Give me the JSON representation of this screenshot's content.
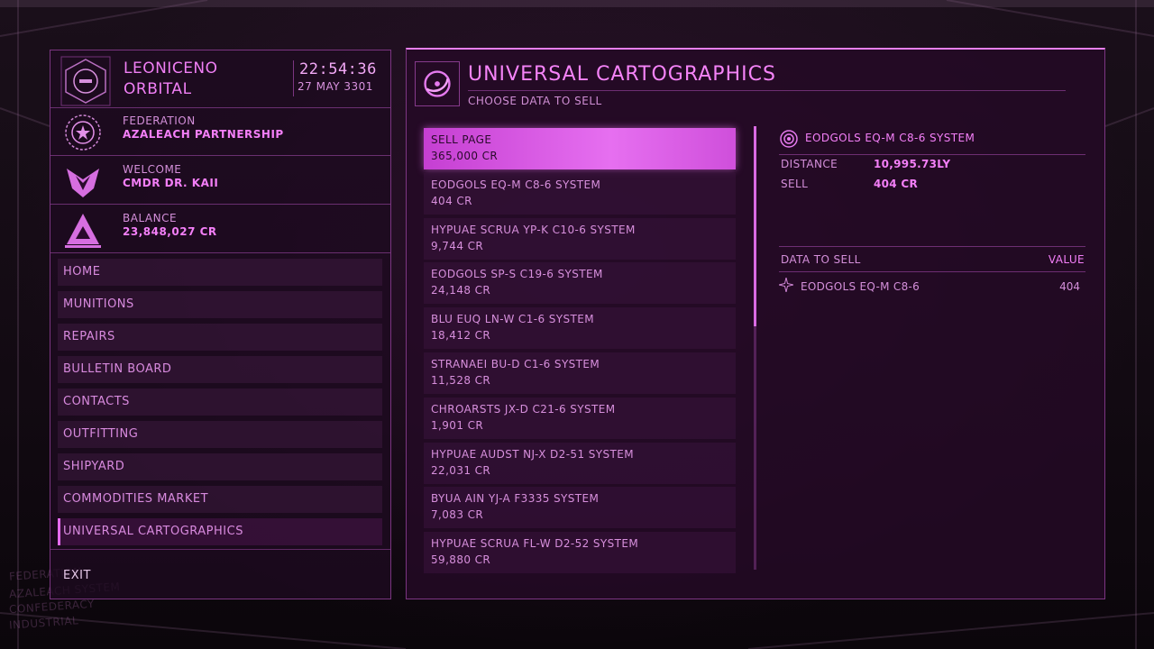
{
  "station": {
    "name_line1": "LEONICENO",
    "name_line2": "ORBITAL",
    "time": "22:54:36",
    "date": "27 MAY 3301"
  },
  "faction": {
    "label": "FEDERATION",
    "value": "AZALEACH PARTNERSHIP"
  },
  "welcome": {
    "label": "WELCOME",
    "value": "CMDR DR. KAII"
  },
  "balance": {
    "label": "BALANCE",
    "value": "23,848,027 CR"
  },
  "nav": {
    "items": [
      {
        "label": "HOME"
      },
      {
        "label": "MUNITIONS"
      },
      {
        "label": "REPAIRS"
      },
      {
        "label": "BULLETIN BOARD"
      },
      {
        "label": "CONTACTS"
      },
      {
        "label": "OUTFITTING"
      },
      {
        "label": "SHIPYARD"
      },
      {
        "label": "COMMODITIES MARKET"
      },
      {
        "label": "UNIVERSAL CARTOGRAPHICS"
      }
    ],
    "selected_index": 8,
    "exit_label": "EXIT"
  },
  "main": {
    "title": "UNIVERSAL CARTOGRAPHICS",
    "subtitle": "CHOOSE DATA TO SELL",
    "list": [
      {
        "name": "SELL PAGE",
        "value": "365,000 CR"
      },
      {
        "name": "EODGOLS EQ-M C8-6 SYSTEM",
        "value": "404 CR"
      },
      {
        "name": "HYPUAE SCRUA YP-K C10-6 SYSTEM",
        "value": "9,744 CR"
      },
      {
        "name": "EODGOLS SP-S C19-6 SYSTEM",
        "value": "24,148 CR"
      },
      {
        "name": "BLU EUQ LN-W C1-6 SYSTEM",
        "value": "18,412 CR"
      },
      {
        "name": "STRANAEI BU-D C1-6 SYSTEM",
        "value": "11,528 CR"
      },
      {
        "name": "CHROARSTS JX-D C21-6 SYSTEM",
        "value": "1,901 CR"
      },
      {
        "name": "HYPUAE AUDST NJ-X D2-51 SYSTEM",
        "value": "22,031 CR"
      },
      {
        "name": "BYUA AIN YJ-A F3335 SYSTEM",
        "value": "7,083 CR"
      },
      {
        "name": "HYPUAE SCRUA FL-W D2-52 SYSTEM",
        "value": "59,880 CR"
      }
    ],
    "selected_index": 0
  },
  "detail": {
    "title": "EODGOLS EQ-M C8-6 SYSTEM",
    "distance_label": "DISTANCE",
    "distance_value": "10,995.73LY",
    "sell_label": "SELL",
    "sell_value": "404 CR",
    "table_header_left": "DATA TO SELL",
    "table_header_right": "VALUE",
    "rows": [
      {
        "name": "EODGOLS EQ-M C8-6",
        "value": "404"
      }
    ]
  },
  "colors": {
    "accent": "#f47ff8",
    "selected_bg": "#e66ff0",
    "panel_border": "#c85ad2"
  }
}
